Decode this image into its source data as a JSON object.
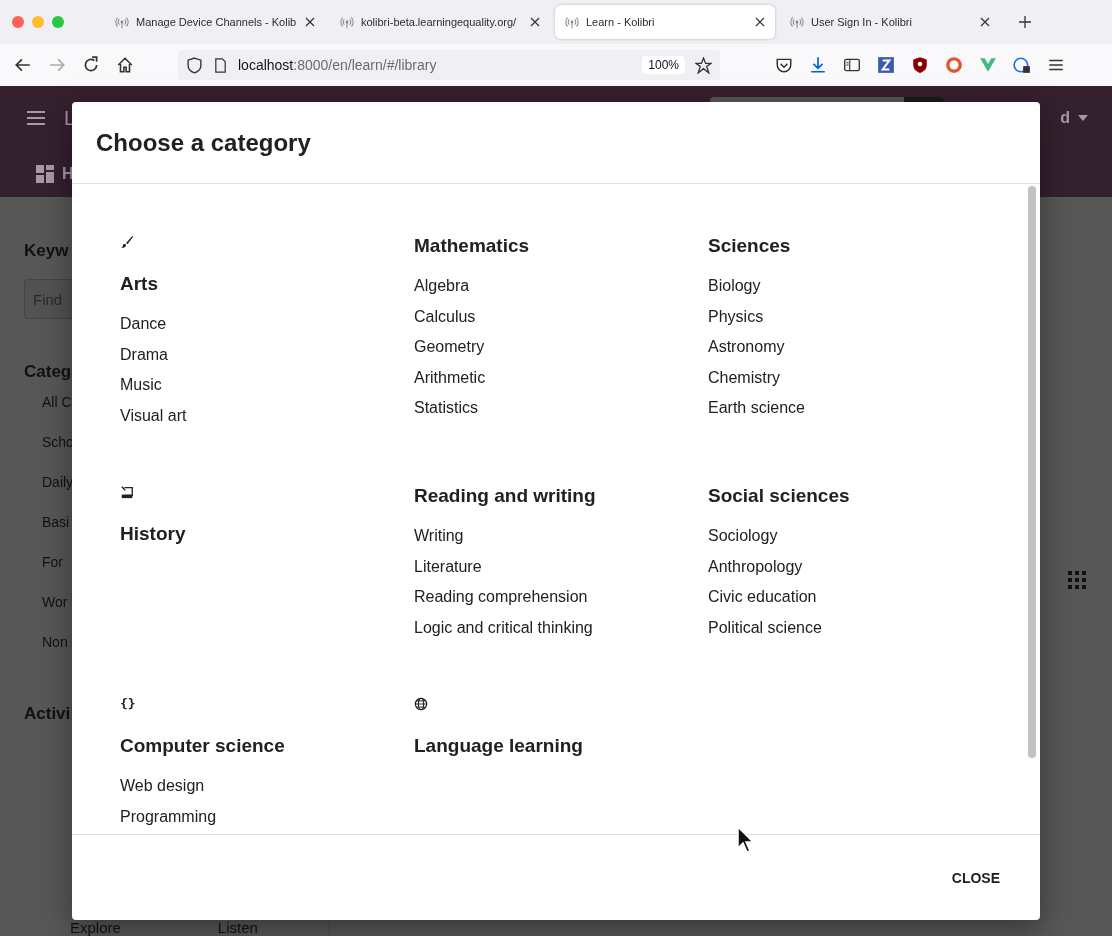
{
  "browser": {
    "tabs": [
      {
        "title": "Manage Device Channels - Kolib",
        "selected": false
      },
      {
        "title": "kolibri-beta.learningequality.org/",
        "selected": false
      },
      {
        "title": "Learn - Kolibri",
        "selected": true
      },
      {
        "title": "User Sign In - Kolibri",
        "selected": false
      }
    ],
    "address": {
      "host": "localhost",
      "path": ":8000/en/learn/#/library"
    },
    "zoom": "100%"
  },
  "background_page": {
    "header_title": "L",
    "nav_item": "H",
    "user_menu": "d",
    "sidebar": {
      "keywords_heading": "Keyw",
      "search_placeholder": "Find",
      "categories_heading": "Categ",
      "categories": [
        "All C",
        "Scho",
        "Daily",
        "Basi",
        "For",
        "Wor",
        "Non"
      ],
      "activities_heading": "Activi"
    },
    "bottom_labels": [
      "Explore",
      "Listen"
    ]
  },
  "dialog": {
    "title": "Choose a category",
    "categories": [
      {
        "title": "Arts",
        "icon": true,
        "items": [
          "Dance",
          "Drama",
          "Music",
          "Visual art"
        ]
      },
      {
        "title": "Mathematics",
        "icon": false,
        "items": [
          "Algebra",
          "Calculus",
          "Geometry",
          "Arithmetic",
          "Statistics"
        ]
      },
      {
        "title": "Sciences",
        "icon": false,
        "items": [
          "Biology",
          "Physics",
          "Astronomy",
          "Chemistry",
          "Earth science"
        ]
      },
      {
        "title": "History",
        "icon": true
      },
      {
        "title": "Reading and writing",
        "icon": false,
        "items": [
          "Writing",
          "Literature",
          "Reading comprehension",
          "Logic and critical thinking"
        ]
      },
      {
        "title": "Social sciences",
        "icon": false,
        "items": [
          "Sociology",
          "Anthropology",
          "Civic education",
          "Political science"
        ]
      },
      {
        "title": "Computer science",
        "glyph": "{}",
        "items": [
          "Web design",
          "Programming"
        ]
      },
      {
        "title": "Language learning",
        "icon": true
      }
    ],
    "close_button": "CLOSE"
  }
}
